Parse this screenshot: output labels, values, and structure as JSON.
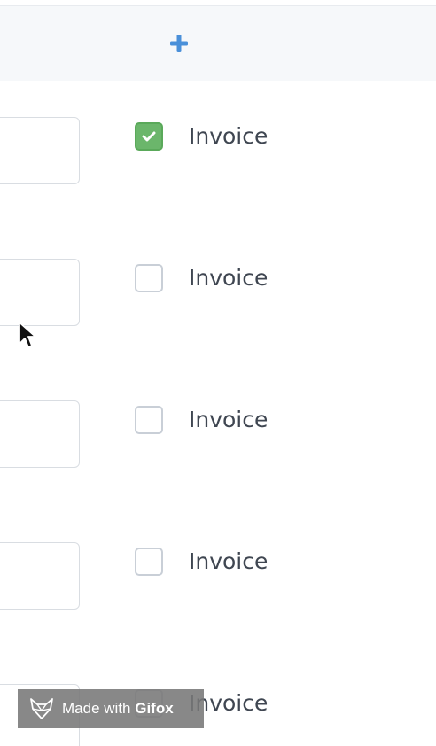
{
  "header": {
    "add_icon": "plus-icon",
    "accent_color": "#4a90d9"
  },
  "rows": [
    {
      "label": "Invoice",
      "checked": true
    },
    {
      "label": "Invoice",
      "checked": false
    },
    {
      "label": "Invoice",
      "checked": false
    },
    {
      "label": "Invoice",
      "checked": false
    },
    {
      "label": "Invoice",
      "checked": false
    }
  ],
  "watermark": {
    "prefix": "Made with",
    "brand": "Gifox",
    "icon": "fox-icon"
  },
  "colors": {
    "checked_fill": "#6bb66b",
    "unchecked_border": "#c9cfd7",
    "label_text": "#3f4651",
    "header_bg": "#f6f8fa"
  }
}
